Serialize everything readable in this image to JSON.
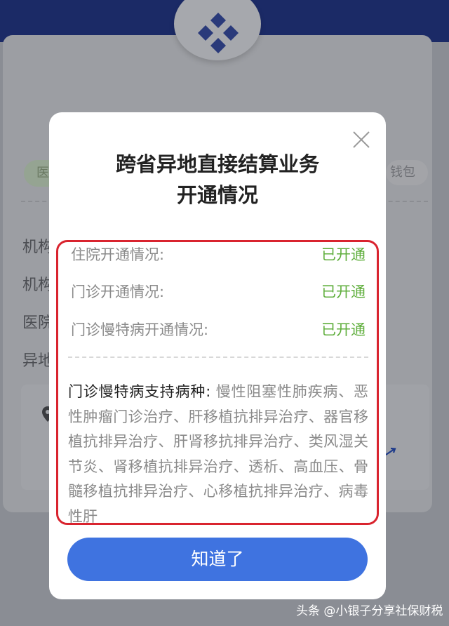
{
  "background": {
    "tag_left": "医",
    "tag_right": "钱包",
    "labels": [
      "机构",
      "机构",
      "医院",
      "异地"
    ]
  },
  "watermark": "头条 @小银子分享社保财税",
  "modal": {
    "title_line1": "跨省异地直接结算业务",
    "title_line2": "开通情况",
    "rows": [
      {
        "label": "住院开通情况:",
        "value": "已开通"
      },
      {
        "label": "门诊开通情况:",
        "value": "已开通"
      },
      {
        "label": "门诊慢特病开通情况:",
        "value": "已开通"
      }
    ],
    "disease_label": "门诊慢特病支持病种:",
    "disease_text": " 慢性阻塞性肺疾病、恶性肿瘤门诊治疗、肝移植抗排异治疗、器官移植抗排异治疗、肝肾移抗排异治疗、类风湿关节炎、肾移植抗排异治疗、透析、高血压、骨髓移植抗排异治疗、心移植抗排异治疗、病毒性肝",
    "button_label": "知道了"
  },
  "colors": {
    "accent": "#3f73e0",
    "status_green": "#5fae3c",
    "highlight_red": "#d9242f"
  }
}
